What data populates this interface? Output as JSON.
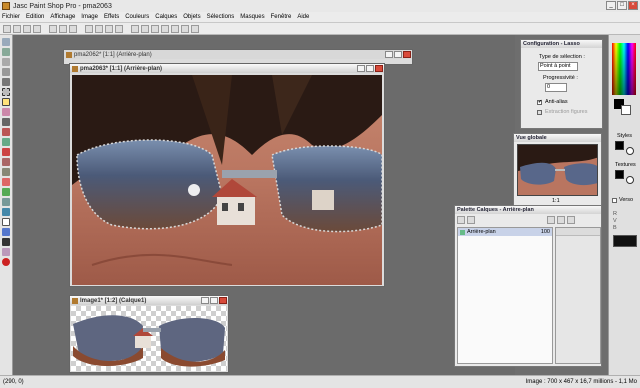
{
  "window": {
    "title": "Jasc Paint Shop Pro - pma2063",
    "minimize": "_",
    "maximize": "□",
    "close": "×"
  },
  "menu": [
    "Fichier",
    "Edition",
    "Affichage",
    "Image",
    "Effets",
    "Couleurs",
    "Calques",
    "Objets",
    "Sélections",
    "Masques",
    "Fenêtre",
    "Aide"
  ],
  "docs": {
    "back": {
      "title": "pma2062* [1:1] (Arrière-plan)"
    },
    "main": {
      "title": "pma2063* [1:1] (Arrière-plan)"
    },
    "image1": {
      "title": "Image1* [1:2] (Calque1)"
    }
  },
  "config": {
    "title": "Configuration - Lasso",
    "selection_type_label": "Type de sélection :",
    "selection_type_value": "Point à point",
    "feather_label": "Progressivité :",
    "feather_value": "0",
    "antialias_label": "Anti-alias",
    "antialias_checked": true,
    "extract_label": "Extraction figures"
  },
  "overview": {
    "title": "Vue globale",
    "zoom": "1:1"
  },
  "layers": {
    "title": "Palette Calques - Arrière-plan",
    "layer_name": "Arrière-plan",
    "opacity": "100"
  },
  "rightpanel": {
    "styles": "Styles",
    "textures": "Textures",
    "reverse": "Verso"
  },
  "status": {
    "coords": "(290, 0)",
    "info": "Image : 700 x 467 x 16,7 millions - 1,1 Mo"
  },
  "colors": {
    "accent": "#c98a2a",
    "close": "#d84a3a"
  }
}
